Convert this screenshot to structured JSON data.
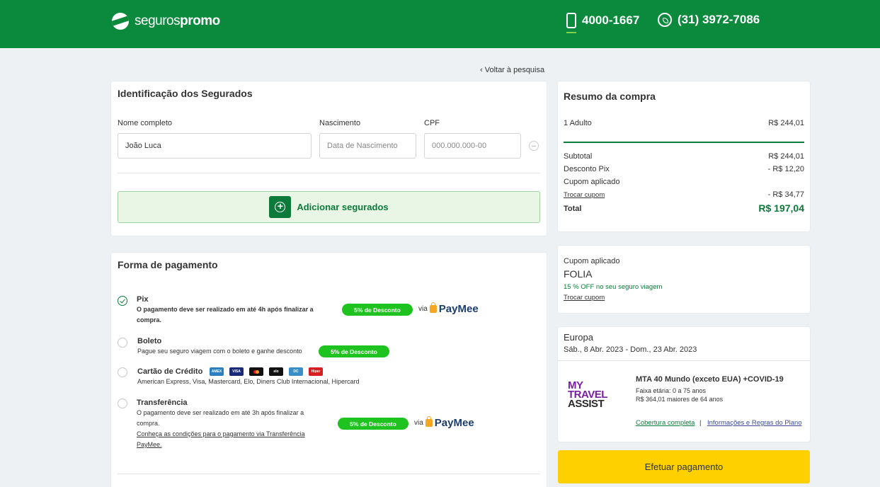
{
  "header": {
    "logo": {
      "light": "seguros",
      "bold": "promo"
    },
    "phone": "4000-1667",
    "whatsapp": "(31) 3972-7086"
  },
  "back_link": "‹ Voltar à pesquisa",
  "identificacao": {
    "title": "Identificação dos Segurados",
    "name_label": "Nome completo",
    "name_value": "João Luca",
    "birth_label": "Nascimento",
    "birth_placeholder": "Data de Nascimento",
    "cpf_label": "CPF",
    "cpf_placeholder": "000.000.000-00",
    "add_button": "Adicionar segurados"
  },
  "pagamento": {
    "title": "Forma de pagamento",
    "methods": [
      {
        "title": "Pix",
        "desc1": "O pagamento deve ser realizado em até 4h após finalizar a",
        "desc2": "compra.",
        "badge": "5% de Desconto",
        "via": "via",
        "provider": "PayMee",
        "selected": true
      },
      {
        "title": "Boleto",
        "desc1": "Pague seu seguro viagem com o boleto e ganhe desconto",
        "badge": "5% de Desconto",
        "selected": false
      },
      {
        "title": "Cartão de Crédito",
        "desc1": "American Express, Visa, Mastercard, Elo, Diners Club Internacional, Hipercard",
        "selected": false
      },
      {
        "title": "Transferência",
        "desc1": "O pagamento deve ser realizado em até 3h após finalizar a",
        "desc2": "compra.",
        "link1": "Conheça as condições para o pagamento via Transferência",
        "link2": "PayMee.",
        "badge": "5% de Desconto",
        "via": "via",
        "provider": "PayMee",
        "selected": false
      }
    ],
    "card_brands": [
      "AMEX",
      "VISA",
      "MC",
      "elo",
      "DC",
      "Hiper"
    ]
  },
  "resumo": {
    "title": "Resumo da compra",
    "adult_label": "1 Adulto",
    "adult_value": "R$ 244,01",
    "subtotal_label": "Subtotal",
    "subtotal_value": "R$ 244,01",
    "pix_label": "Desconto Pix",
    "pix_value": "- R$ 12,20",
    "coupon_label": "Cupom aplicado",
    "change_coupon": "Trocar cupom",
    "coupon_value": "- R$ 34,77",
    "total_label": "Total",
    "total_value": "R$ 197,04"
  },
  "cupom": {
    "label": "Cupom aplicado",
    "code": "FOLIA",
    "desc": "15 % OFF no seu seguro viagem",
    "change": "Trocar cupom"
  },
  "destino": {
    "region": "Europa",
    "dates": "Sáb., 8 Abr. 2023 - Dom., 23 Abr. 2023",
    "logo_line1": "MY TRAVEL",
    "logo_line2": "ASSIST",
    "plan": "MTA 40 Mundo (exceto EUA) +COVID-19",
    "age": "Faixa etária: 0 a 75 anos",
    "price_older": "R$ 364,01 maiores de 64 anos",
    "link_coverage": "Cobertura completa",
    "separator": "|",
    "link_rules": "Informações e Regras do Plano"
  },
  "pay_button": "Efetuar pagamento",
  "colors": {
    "brand_green": "#0b8a3d",
    "badge_green": "#1fc31f",
    "cta_yellow": "#ffd000"
  }
}
